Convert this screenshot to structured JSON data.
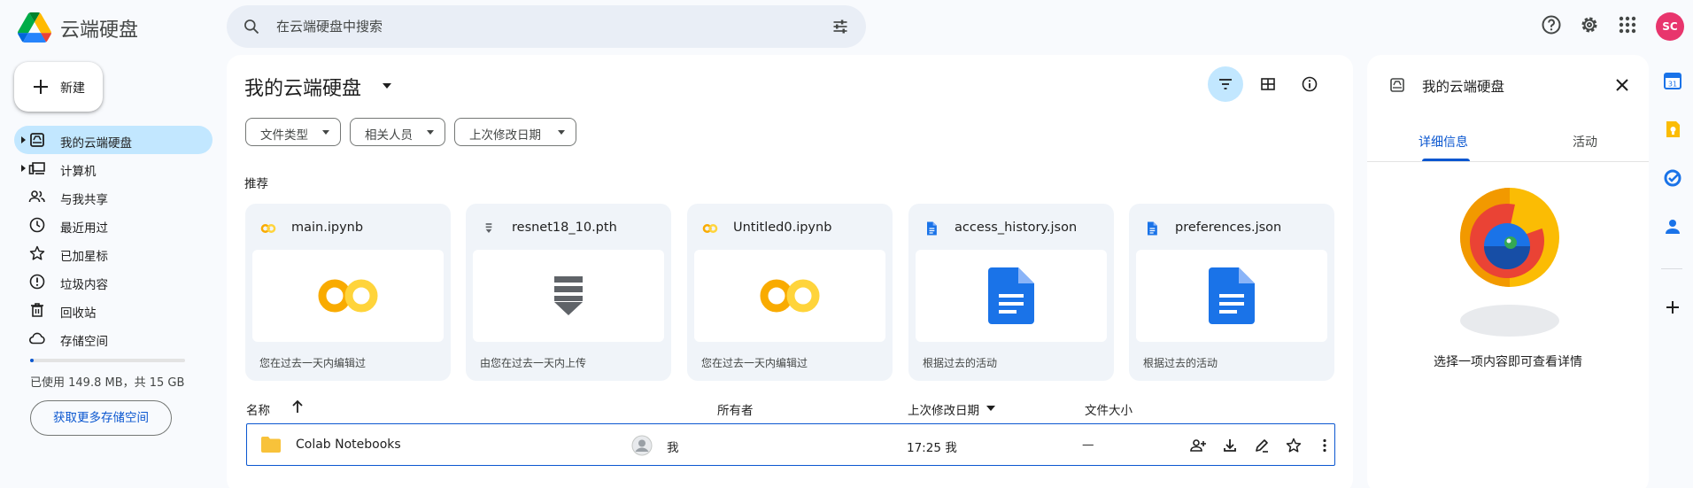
{
  "header": {
    "app_title": "云端硬盘",
    "search_placeholder": "在云端硬盘中搜索",
    "avatar_initials": "SC"
  },
  "sidebar": {
    "new_label": "新建",
    "items": [
      {
        "label": "我的云端硬盘",
        "icon": "drive-icon",
        "active": true
      },
      {
        "label": "计算机",
        "icon": "computer-icon"
      },
      {
        "label": "与我共享",
        "icon": "people-icon"
      },
      {
        "label": "最近用过",
        "icon": "clock-icon"
      },
      {
        "label": "已加星标",
        "icon": "star-icon"
      },
      {
        "label": "垃圾内容",
        "icon": "spam-icon"
      },
      {
        "label": "回收站",
        "icon": "trash-icon"
      },
      {
        "label": "存储空间",
        "icon": "cloud-icon"
      }
    ],
    "storage_used_fraction": 0.01,
    "storage_text": "已使用 149.8 MB，共 15 GB",
    "more_storage_label": "获取更多存储空间"
  },
  "main": {
    "title": "我的云端硬盘",
    "filters": [
      "文件类型",
      "相关人员",
      "上次修改日期"
    ],
    "suggested_label": "推荐",
    "cards": [
      {
        "name": "main.ipynb",
        "icon": "colab-icon",
        "reason": "您在过去一天内编辑过"
      },
      {
        "name": "resnet18_10.pth",
        "icon": "generic-file-icon",
        "reason": "由您在过去一天内上传"
      },
      {
        "name": "Untitled0.ipynb",
        "icon": "colab-icon",
        "reason": "您在过去一天内编辑过"
      },
      {
        "name": "access_history.json",
        "icon": "doc-icon",
        "reason": "根据过去的活动"
      },
      {
        "name": "preferences.json",
        "icon": "doc-icon",
        "reason": "根据过去的活动"
      }
    ],
    "columns": {
      "name": "名称",
      "owner": "所有者",
      "modified": "上次修改日期",
      "size": "文件大小"
    },
    "rows": [
      {
        "name": "Colab Notebooks",
        "owner": "我",
        "modified": "17:25 我",
        "size": "—"
      }
    ]
  },
  "details_panel": {
    "title": "我的云端硬盘",
    "tabs": [
      "详细信息",
      "活动"
    ],
    "empty_message": "选择一项内容即可查看详情"
  },
  "colors": {
    "accent": "#0b57d0",
    "active_bg": "#c2e7ff",
    "avatar": "#e8356d",
    "colab_orange": "#f9ab00",
    "colab_yellow": "#ffd43b",
    "doc_blue": "#1a73e8"
  }
}
